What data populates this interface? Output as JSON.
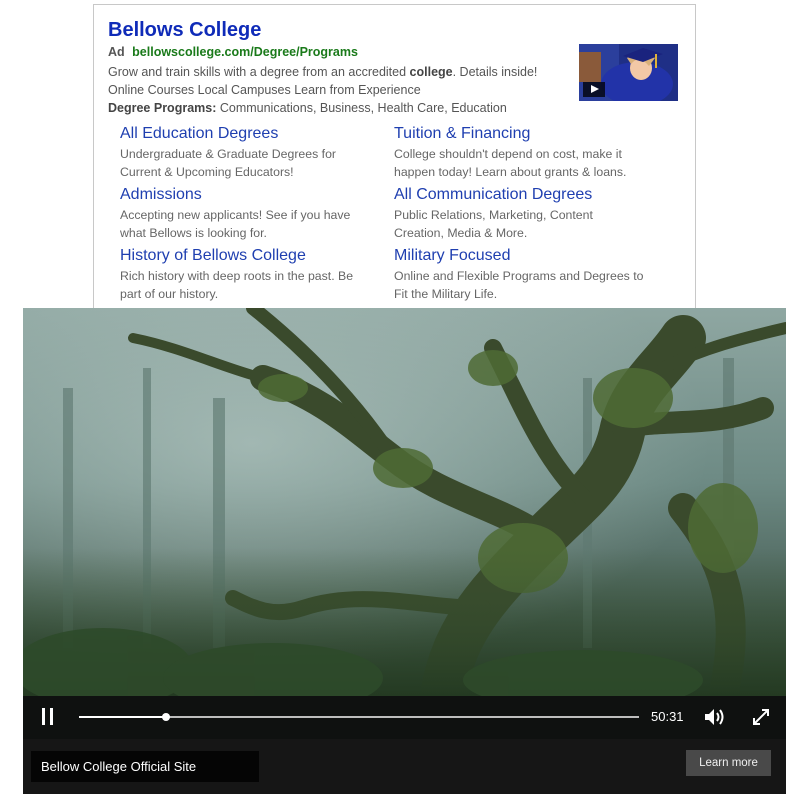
{
  "ad": {
    "title": "Bellows College",
    "badge": "Ad",
    "url": "bellowscollege.com/Degree/Programs",
    "desc_line1_a": "Grow and train skills with  a degree from an accredited ",
    "desc_line1_bold": "college",
    "desc_line1_b": ". Details inside!",
    "desc_line2": "Online Courses  Local Campuses  Learn from Experience",
    "desc_line3_label": "Degree Programs:",
    "desc_line3_value": " Communications, Business, Health Care, Education",
    "thumbnail_icon": "play-icon",
    "sitelinks": [
      {
        "title": "All Education Degrees",
        "desc": "Undergraduate & Graduate Degrees for Current & Upcoming Educators!"
      },
      {
        "title": "Tuition & Financing",
        "desc": "College shouldn't depend on cost, make it happen today! Learn about grants & loans."
      },
      {
        "title": "Admissions",
        "desc": "Accepting new applicants! See if you have what Bellows is looking for."
      },
      {
        "title": "All Communication Degrees",
        "desc": "Public Relations, Marketing, Content Creation, Media & More."
      },
      {
        "title": "History of Bellows College",
        "desc": "Rich history with deep roots in the past. Be part of our history."
      },
      {
        "title": "Military Focused",
        "desc": "Online and Flexible  Programs and Degrees to Fit the Military Life."
      }
    ]
  },
  "player": {
    "time": "50:31",
    "progress": 0.155,
    "site_label": "Bellow College Official Site",
    "learn_more": "Learn more",
    "icons": {
      "pause": "pause-icon",
      "volume": "volume-icon",
      "fullscreen": "fullscreen-icon"
    }
  },
  "colors": {
    "title_blue": "#0f2bb8",
    "url_green": "#1a7a1a",
    "link_blue": "#1f3fb0"
  }
}
